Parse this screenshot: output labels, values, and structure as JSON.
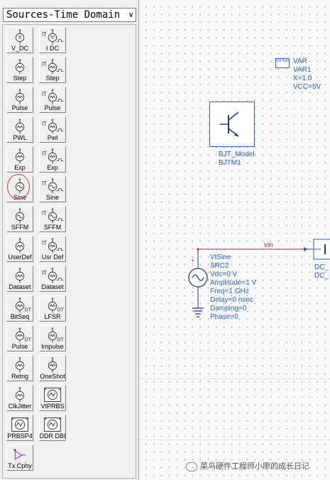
{
  "palette": {
    "library_name": "Sources-Time Domain",
    "items": [
      {
        "label": "V_DC",
        "icon": "dc-voltage-source-icon"
      },
      {
        "label": "I DC",
        "icon": "dc-current-source-icon"
      },
      {
        "label": "Step",
        "icon": "step-voltage-source-icon"
      },
      {
        "label": "Step",
        "icon": "step-current-source-icon"
      },
      {
        "label": "Pulse",
        "icon": "pulse-voltage-source-icon"
      },
      {
        "label": "Pulse",
        "icon": "pulse-current-source-icon"
      },
      {
        "label": "PWL",
        "icon": "pwl-voltage-source-icon"
      },
      {
        "label": "Pwl",
        "icon": "pwl-current-source-icon"
      },
      {
        "label": "Exp",
        "icon": "exp-voltage-source-icon"
      },
      {
        "label": "Exp",
        "icon": "exp-current-source-icon"
      },
      {
        "label": "Sine",
        "icon": "sine-voltage-source-icon"
      },
      {
        "label": "Sine",
        "icon": "sine-current-source-icon"
      },
      {
        "label": "SFFM",
        "icon": "sffm-voltage-source-icon"
      },
      {
        "label": "SFFM",
        "icon": "sffm-current-source-icon"
      },
      {
        "label": "UserDef",
        "icon": "userdef-voltage-source-icon"
      },
      {
        "label": "Usr Def",
        "icon": "userdef-current-source-icon"
      },
      {
        "label": "Dataset",
        "icon": "dataset-voltage-source-icon"
      },
      {
        "label": "Dataset",
        "icon": "dataset-current-source-icon"
      },
      {
        "label": "BitSeq",
        "icon": "bitseq-source-icon"
      },
      {
        "label": "LFSR",
        "icon": "lfsr-source-icon"
      },
      {
        "label": "Pulse",
        "icon": "dt-pulse-source-icon"
      },
      {
        "label": "Impulse",
        "icon": "impulse-source-icon"
      },
      {
        "label": "Retrig",
        "icon": "retrig-source-icon"
      },
      {
        "label": "OneShot",
        "icon": "oneshot-source-icon"
      },
      {
        "label": "ClkJitter",
        "icon": "clkjitter-source-icon"
      },
      {
        "label": "VtPRBS",
        "icon": "vtprbs-source-icon"
      },
      {
        "label": "PRBSP4",
        "icon": "prbsp4-source-icon"
      },
      {
        "label": "DDR DBI",
        "icon": "ddr-dbi-source-icon"
      },
      {
        "label": "Tx Cphy",
        "icon": "tx-cphy-source-icon"
      }
    ]
  },
  "schematic": {
    "var_block": {
      "icon_text": "Var Eqn",
      "lines": [
        "VAR",
        "VAR1",
        "X=1.0",
        "VCC=5V"
      ]
    },
    "bjt_model": {
      "lines": [
        "BJT_Model",
        "BJTM1"
      ]
    },
    "wire_label": "vin",
    "source": {
      "plus": "+",
      "minus": "-",
      "lines": [
        "VtSine",
        "SRC2",
        "Vdc=0 V",
        "Amplitude=1 V",
        "Freq=1 GHz",
        "Delay=0 nsec",
        "Damping=0",
        "Phase=0"
      ]
    },
    "dc_block": {
      "lines": [
        "DC_",
        "DC_"
      ]
    }
  },
  "watermark": "菜鸟硬件工程师小廖的成长日记"
}
